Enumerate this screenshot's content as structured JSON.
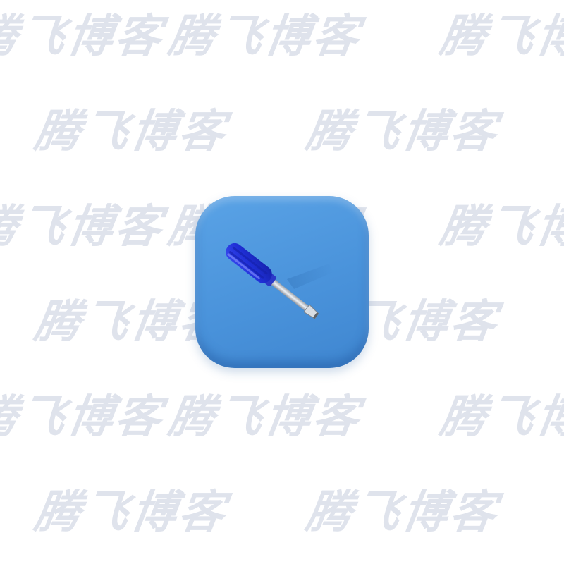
{
  "watermark": {
    "text": "腾飞博客",
    "color": "#dfe3ec"
  },
  "app_icon": {
    "icon": "screwdriver-icon",
    "tile_color": "#4a93db",
    "handle_color": "#1f2fd6",
    "shaft_color": "#c9ced6"
  }
}
